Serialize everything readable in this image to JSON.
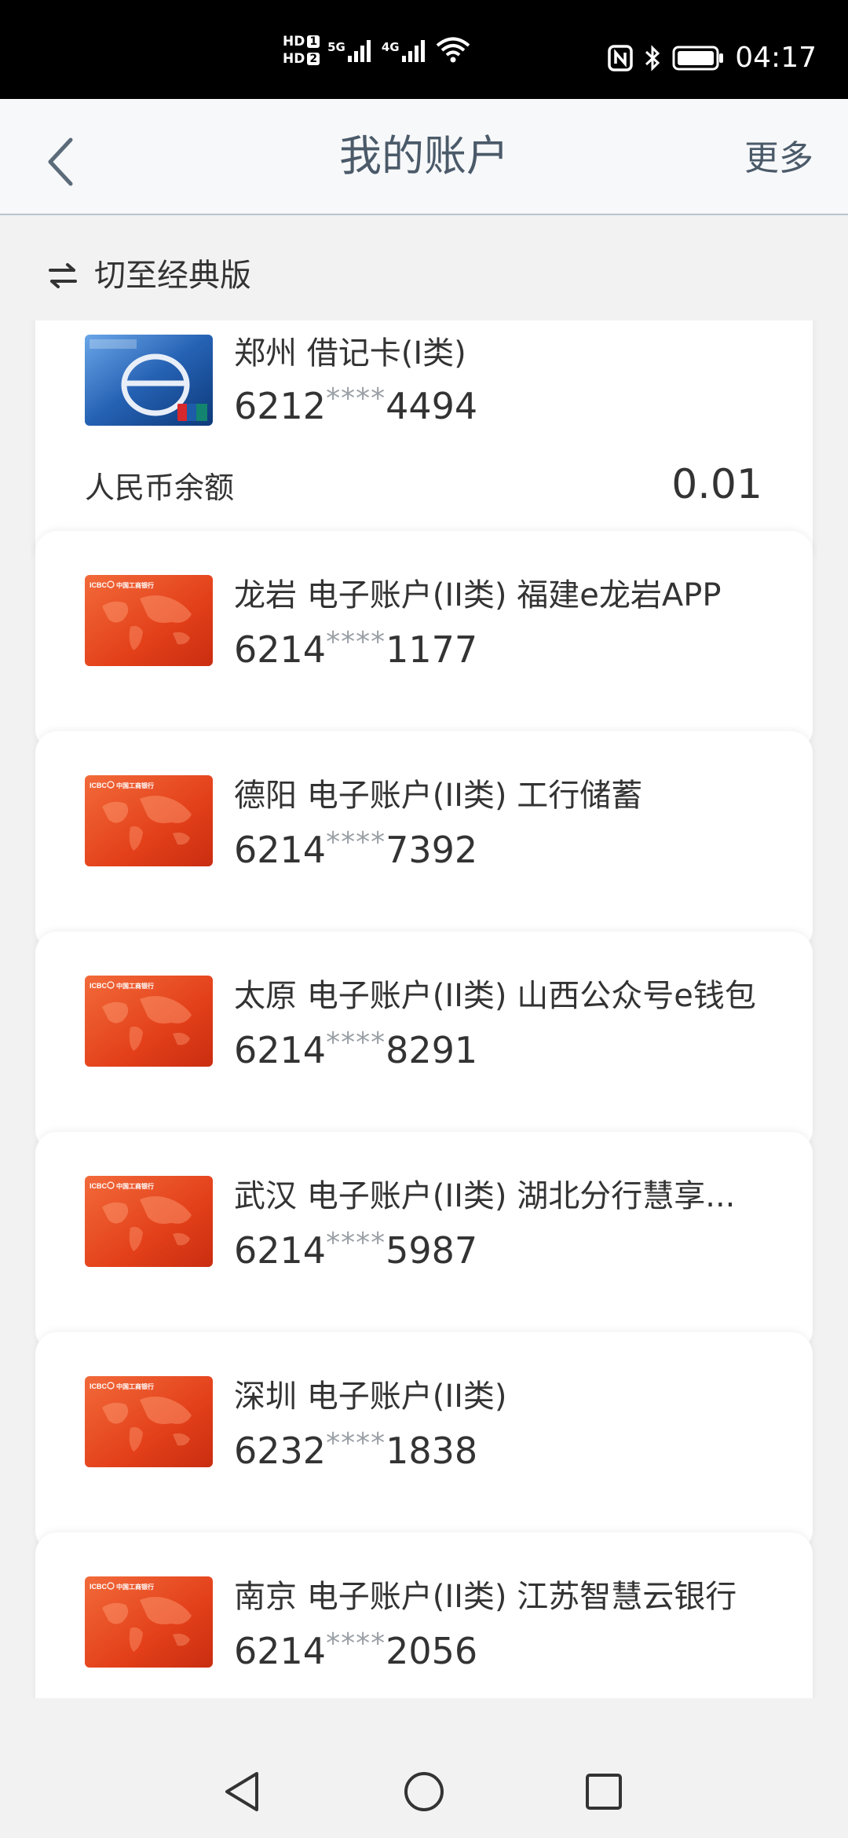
{
  "status_bar": {
    "hd1": "HD",
    "hd1_num": "1",
    "hd2": "HD",
    "hd2_num": "2",
    "net1": "5G",
    "net2": "4G",
    "time": "04:17",
    "icons": [
      "nfc-icon",
      "bluetooth-icon",
      "battery-icon",
      "wifi-icon",
      "signal-icon"
    ]
  },
  "header": {
    "title": "我的账户",
    "more_label": "更多",
    "back_icon": "chevron-left-icon"
  },
  "switch": {
    "label": "切至经典版",
    "icon": "swap-icon"
  },
  "accounts": [
    {
      "name": "郑州 借记卡(I类)",
      "number_prefix": "6212",
      "number_mask": "****",
      "number_suffix": "4494",
      "balance_label": "人民币余额",
      "balance_value": "0.01",
      "card_style": "blue"
    },
    {
      "name": "龙岩 电子账户(II类) 福建e龙岩APP",
      "number_prefix": "6214",
      "number_mask": "****",
      "number_suffix": "1177",
      "card_style": "red"
    },
    {
      "name": "德阳 电子账户(II类) 工行储蓄",
      "number_prefix": "6214",
      "number_mask": "****",
      "number_suffix": "7392",
      "card_style": "red"
    },
    {
      "name": "太原 电子账户(II类) 山西公众号e钱包",
      "number_prefix": "6214",
      "number_mask": "****",
      "number_suffix": "8291",
      "card_style": "red"
    },
    {
      "name": "武汉 电子账户(II类) 湖北分行慧享...",
      "number_prefix": "6214",
      "number_mask": "****",
      "number_suffix": "5987",
      "card_style": "red"
    },
    {
      "name": "深圳 电子账户(II类)",
      "number_prefix": "6232",
      "number_mask": "****",
      "number_suffix": "1838",
      "card_style": "red"
    },
    {
      "name": "南京 电子账户(II类) 江苏智慧云银行",
      "number_prefix": "6214",
      "number_mask": "****",
      "number_suffix": "2056",
      "card_style": "red"
    }
  ],
  "card_art": {
    "brand_text": "ICBC",
    "bank_name": "中国工商银行"
  },
  "nav_bar": {
    "icons": [
      "back-triangle-icon",
      "home-circle-icon",
      "recents-square-icon"
    ]
  },
  "colors": {
    "header_text": "#4b5a69",
    "accent_orange": "#f2b342",
    "card_red": "#e8431c",
    "card_blue": "#1f5fae",
    "background": "#f2f2f2"
  }
}
